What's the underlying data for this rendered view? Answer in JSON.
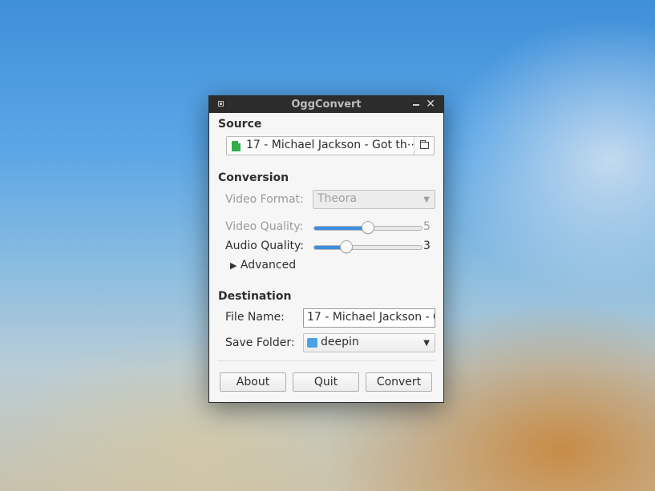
{
  "window": {
    "title": "OggConvert"
  },
  "source": {
    "heading": "Source",
    "file_name": "17 - Michael Jackson - Got th⋯"
  },
  "conversion": {
    "heading": "Conversion",
    "video_format_label": "Video Format:",
    "video_format_value": "Theora",
    "video_quality_label": "Video Quality:",
    "video_quality_value": "5",
    "video_quality_fraction": 0.5,
    "audio_quality_label": "Audio Quality:",
    "audio_quality_value": "3",
    "audio_quality_fraction": 0.3,
    "advanced_label": "Advanced"
  },
  "destination": {
    "heading": "Destination",
    "file_name_label": "File Name:",
    "file_name_value": "17 - Michael Jackson - G",
    "save_folder_label": "Save Folder:",
    "save_folder_value": "deepin"
  },
  "buttons": {
    "about": "About",
    "quit": "Quit",
    "convert": "Convert"
  },
  "colors": {
    "accent": "#3b8fe0",
    "file_icon": "#2fae49",
    "titlebar": "#2c2c2c"
  }
}
